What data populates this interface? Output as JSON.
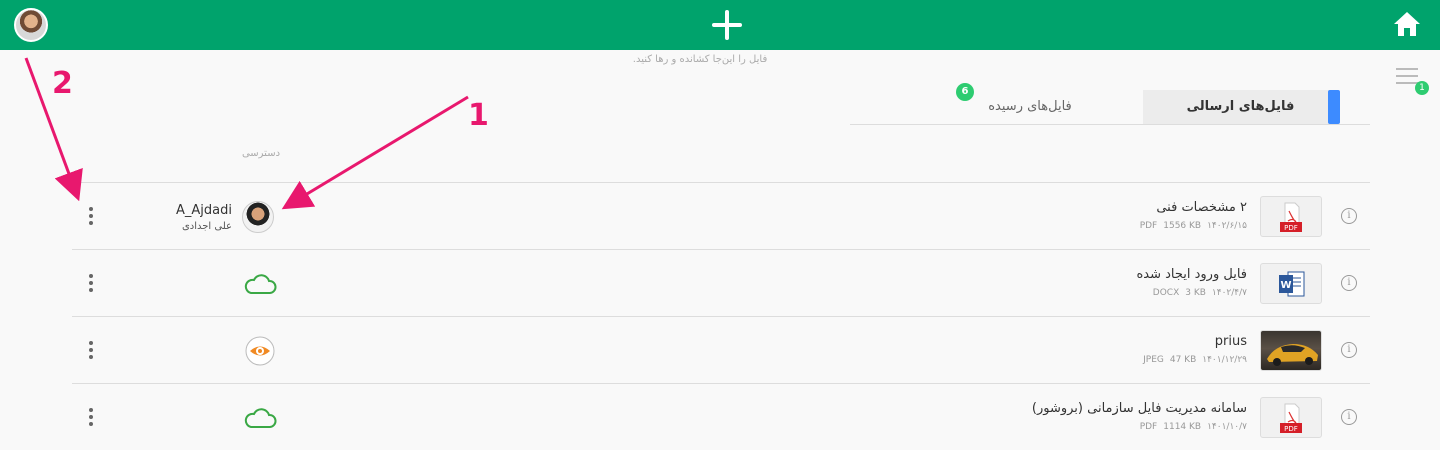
{
  "topbar": {
    "add_icon": "plus-icon",
    "home_icon": "home-icon"
  },
  "drop_hint": "فایل را این‌جا کشانده و رها کنید.",
  "menu": {
    "badge": "1"
  },
  "tabs": {
    "sent_label": "فایل‌های ارسالی",
    "received_label": "فایل‌های رسیده",
    "received_badge": "6"
  },
  "columns": {
    "access_label": "دسترسی"
  },
  "files": [
    {
      "title": "۲ مشخصات فنی",
      "type": "PDF",
      "size": "1556 KB",
      "date": "۱۴۰۲/۶/۱۵",
      "owner_name": "A_Ajdadi",
      "owner_sub": "علی اجدادی",
      "access": "user-avatar"
    },
    {
      "title": "فایل ورود ایجاد شده",
      "type": "DOCX",
      "size": "3 KB",
      "date": "۱۴۰۲/۴/۷",
      "access": "cloud-icon"
    },
    {
      "title": "prius",
      "type": "JPEG",
      "size": "47 KB",
      "date": "۱۴۰۱/۱۲/۲۹",
      "access": "eye-icon"
    },
    {
      "title": "سامانه مدیریت فایل سازمانی (بروشور)",
      "type": "PDF",
      "size": "1114 KB",
      "date": "۱۴۰۱/۱۰/۷",
      "access": "cloud-icon"
    }
  ],
  "annotations": {
    "one": "1",
    "two": "2"
  },
  "colors": {
    "topbar": "#00a36c",
    "badge": "#2ecc71",
    "tab_accent": "#3d8bff",
    "annotation": "#e8186e",
    "cloud": "#3aa845",
    "eye": "#f08a24"
  }
}
